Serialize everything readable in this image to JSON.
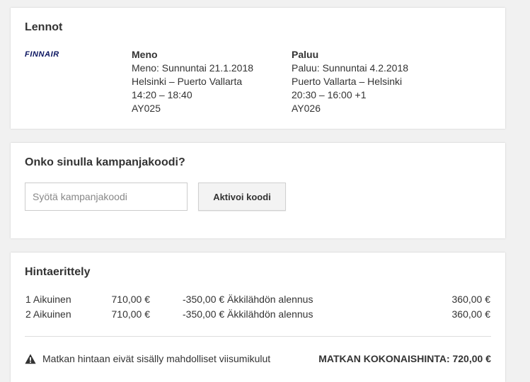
{
  "flights": {
    "title": "Lennot",
    "airline_logo": "FINNAIR",
    "outbound": {
      "heading": "Meno",
      "date": "Meno: Sunnuntai 21.1.2018",
      "route": "Helsinki – Puerto Vallarta",
      "time": "14:20 – 18:40",
      "flight_no": "AY025"
    },
    "return": {
      "heading": "Paluu",
      "date": "Paluu: Sunnuntai 4.2.2018",
      "route": "Puerto Vallarta – Helsinki",
      "time": "20:30 – 16:00 +1",
      "flight_no": "AY026"
    }
  },
  "promo": {
    "title": "Onko sinulla kampanjakoodi?",
    "input_placeholder": "Syötä kampanjakoodi",
    "input_value": "",
    "button_label": "Aktivoi koodi"
  },
  "price": {
    "title": "Hintaerittely",
    "rows": [
      {
        "pax": "1 Aikuinen",
        "base": "710,00 €",
        "discount": "-350,00 € Äkkilähdön alennus",
        "total": "360,00 €"
      },
      {
        "pax": "2 Aikuinen",
        "base": "710,00 €",
        "discount": "-350,00 € Äkkilähdön alennus",
        "total": "360,00 €"
      }
    ],
    "notice": "Matkan hintaan eivät sisälly mahdolliset viisumikulut",
    "notice_icon": "warning-icon",
    "grand_total": "MATKAN KOKONAISHINTA: 720,00 €"
  },
  "colors": {
    "background": "#f1f1f1",
    "card": "#ffffff",
    "text": "#333333",
    "logo": "#0b1560"
  }
}
